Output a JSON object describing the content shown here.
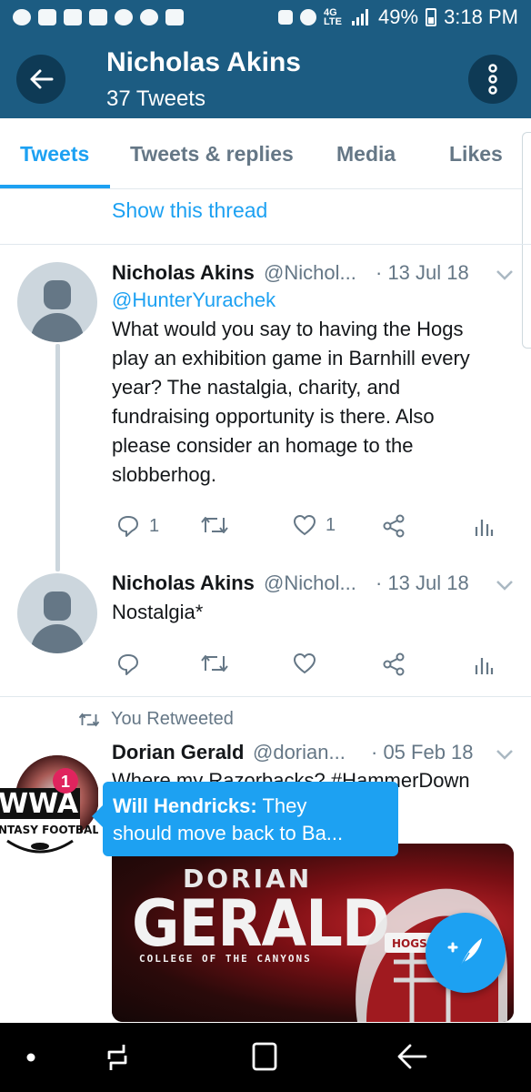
{
  "status_bar": {
    "network": "4G LTE",
    "battery": "49%",
    "time": "3:18 PM"
  },
  "header": {
    "title": "Nicholas Akins",
    "subtitle": "37 Tweets"
  },
  "tabs": [
    {
      "label": "Tweets",
      "active": true
    },
    {
      "label": "Tweets & replies",
      "active": false
    },
    {
      "label": "Media",
      "active": false
    },
    {
      "label": "Likes",
      "active": false
    }
  ],
  "thread_link": "Show this thread",
  "tweets": [
    {
      "name": "Nicholas Akins",
      "handle": "@Nichol...",
      "date": "· 13 Jul 18",
      "mention": "@HunterYurachek",
      "text_lines": [
        "What would you say to having the Hogs",
        "play an exhibition game in Barnhill every",
        "year? The nastalgia, charity, and",
        "fundraising opportunity is there. Also",
        "please consider an homage to the",
        "slobberhog."
      ],
      "replies": "1",
      "likes": "1"
    },
    {
      "name": "Nicholas Akins",
      "handle": "@Nichol...",
      "date": "· 13 Jul 18",
      "text": "Nostalgia*"
    }
  ],
  "retweet": {
    "label": "You Retweeted",
    "name": "Dorian Gerald",
    "handle": "@dorian...",
    "date": "· 05 Feb 18",
    "text": "Where my Razorbacks? #HammerDown",
    "avatar_badge": "1",
    "avatar_text_top": "WWA",
    "avatar_text_bottom": "NTASY FOOTBALL",
    "media": {
      "line1": "DORIAN",
      "line2": "GERALD",
      "line3": "COLLEGE OF THE CANYONS",
      "helmet_text": "HOGS"
    }
  },
  "tooltip": {
    "author": "Will Hendricks:",
    "line1": "They",
    "line2": "should move back to Ba..."
  },
  "colors": {
    "header_bg": "#1c5c82",
    "accent": "#1da1f2",
    "muted": "#657786"
  }
}
